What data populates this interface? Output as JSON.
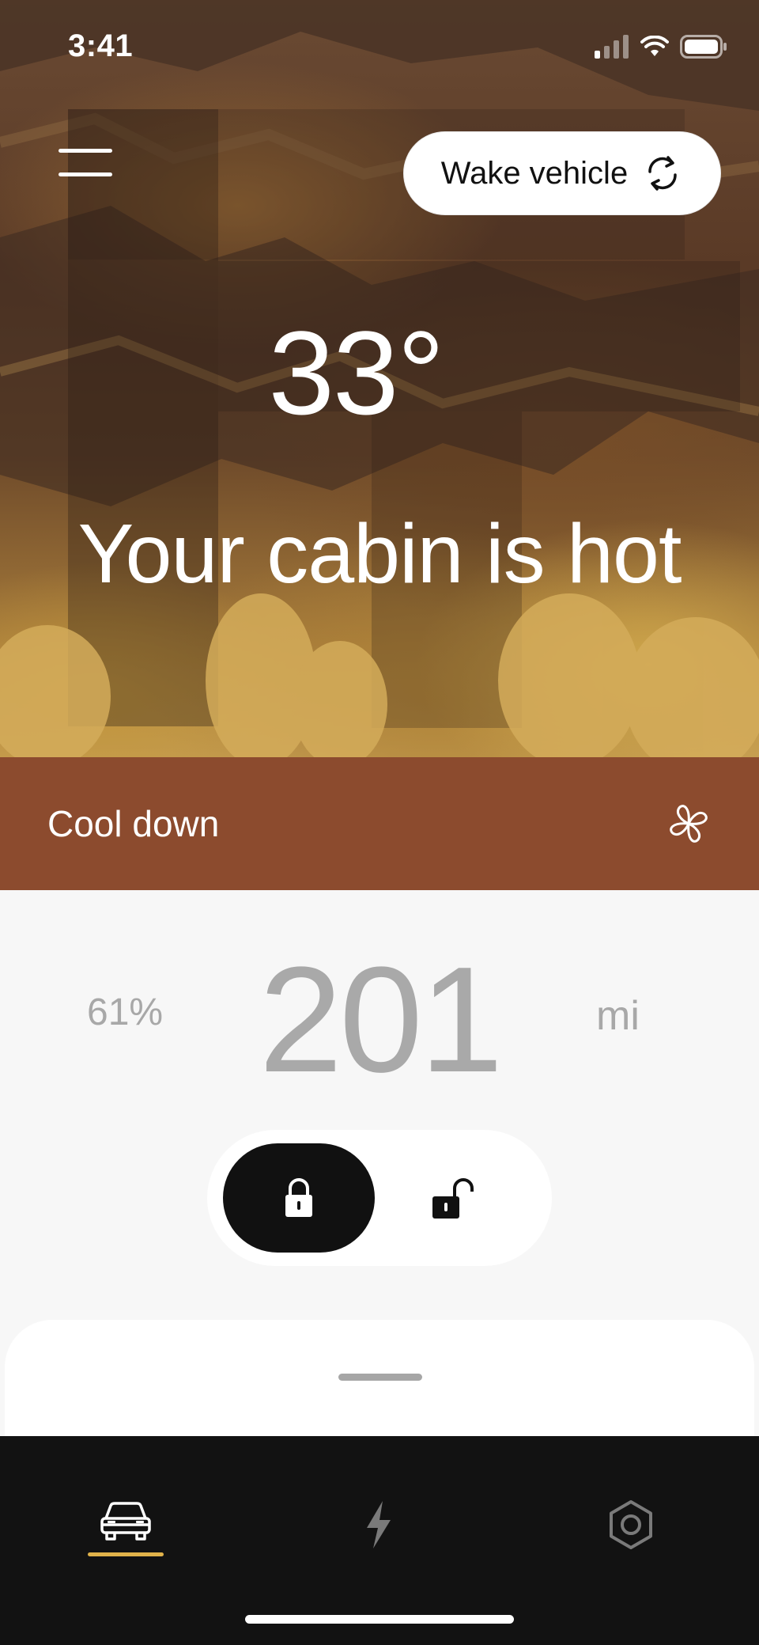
{
  "status_bar": {
    "time": "3:41",
    "icons": [
      "cellular-signal-icon",
      "wifi-icon",
      "battery-icon"
    ]
  },
  "header": {
    "menu_icon": "hamburger-menu-icon",
    "wake_button": {
      "label": "Wake vehicle",
      "icon": "refresh-cycle-icon"
    }
  },
  "climate": {
    "temperature": "33°",
    "message": "Your cabin is hot",
    "action": {
      "label": "Cool down",
      "icon": "fan-icon"
    }
  },
  "range": {
    "battery_percent": "61%",
    "value": "201",
    "unit": "mi"
  },
  "lock_control": {
    "state": "locked",
    "options": [
      "lock",
      "unlock"
    ]
  },
  "tabs": [
    {
      "name": "vehicle",
      "icon": "car-icon",
      "active": true
    },
    {
      "name": "charging",
      "icon": "lightning-bolt-icon",
      "active": false
    },
    {
      "name": "settings",
      "icon": "hexagon-nut-icon",
      "active": false
    }
  ],
  "colors": {
    "accent_bar": "#8c4b2e",
    "active_tab_indicator": "#e0b24a",
    "tabbar_bg": "#121212",
    "range_text": "#a9a9a9"
  }
}
